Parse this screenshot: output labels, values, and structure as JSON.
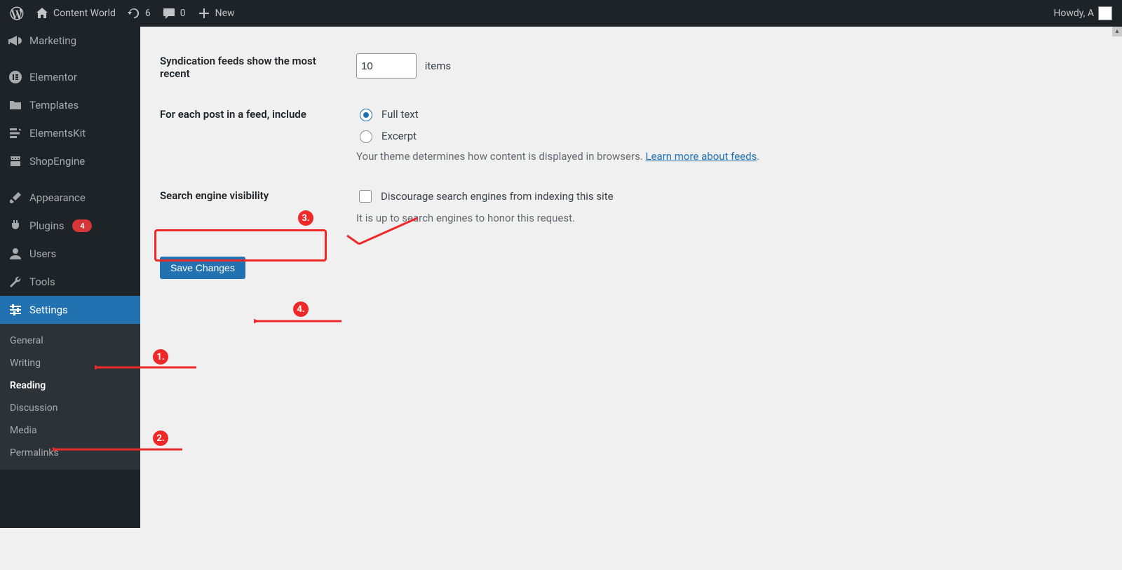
{
  "adminbar": {
    "site_name": "Content World",
    "updates_count": "6",
    "comments_count": "0",
    "new_label": "New",
    "howdy": "Howdy, A"
  },
  "sidebar": {
    "items": [
      {
        "label": "Marketing"
      },
      {
        "label": "Elementor"
      },
      {
        "label": "Templates"
      },
      {
        "label": "ElementsKit"
      },
      {
        "label": "ShopEngine"
      },
      {
        "label": "Appearance"
      },
      {
        "label": "Plugins",
        "badge": "4"
      },
      {
        "label": "Users"
      },
      {
        "label": "Tools"
      },
      {
        "label": "Settings"
      }
    ],
    "submenu": [
      {
        "label": "General"
      },
      {
        "label": "Writing"
      },
      {
        "label": "Reading"
      },
      {
        "label": "Discussion"
      },
      {
        "label": "Media"
      },
      {
        "label": "Permalinks"
      }
    ]
  },
  "settings": {
    "syndication": {
      "label": "Syndication feeds show the most recent",
      "value": "10",
      "unit": "items"
    },
    "feed_include": {
      "label": "For each post in a feed, include",
      "opt_full": "Full text",
      "opt_excerpt": "Excerpt",
      "note_pre": "Your theme determines how content is displayed in browsers. ",
      "note_link": "Learn more about feeds",
      "note_post": "."
    },
    "search_vis": {
      "label": "Search engine visibility",
      "checkbox_label": "Discourage search engines from indexing this site",
      "note": "It is up to search engines to honor this request."
    },
    "save_label": "Save Changes"
  },
  "annotations": {
    "n1": "1.",
    "n2": "2.",
    "n3": "3.",
    "n4": "4."
  }
}
